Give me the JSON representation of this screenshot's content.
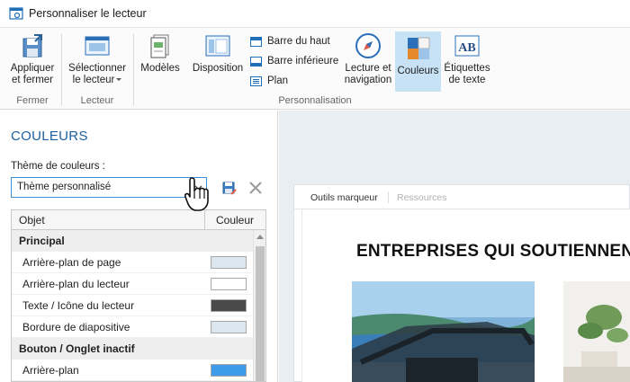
{
  "window": {
    "title": "Personnaliser le lecteur"
  },
  "ribbon": {
    "apply": {
      "line1": "Appliquer",
      "line2": "et fermer"
    },
    "select_player": {
      "line1": "Sélectionner",
      "line2": "le lecteur"
    },
    "templates": {
      "label": "Modèles"
    },
    "layout": {
      "label": "Disposition"
    },
    "top_bar": {
      "label": "Barre du haut"
    },
    "bottom_bar": {
      "label": "Barre inférieure"
    },
    "outline": {
      "label": "Plan"
    },
    "playback": {
      "line1": "Lecture et",
      "line2": "navigation"
    },
    "colors": {
      "label": "Couleurs"
    },
    "text_labels": {
      "line1": "Étiquettes",
      "line2": "de texte"
    },
    "groups": {
      "close": "Fermer",
      "player": "Lecteur",
      "customization": "Personnalisation"
    }
  },
  "panel": {
    "title": "COULEURS",
    "theme_label": "Thème de couleurs :",
    "theme_value": "Thème personnalisé",
    "table": {
      "col_object": "Objet",
      "col_color": "Couleur",
      "rows": [
        {
          "type": "section",
          "label": "Principal"
        },
        {
          "type": "item",
          "label": "Arrière-plan de page",
          "color": "#dce6ef"
        },
        {
          "type": "item",
          "label": "Arrière-plan du lecteur",
          "color": "#ffffff"
        },
        {
          "type": "item",
          "label": "Texte / Icône du lecteur",
          "color": "#4a4a4a"
        },
        {
          "type": "item",
          "label": "Bordure de diapositive",
          "color": "#dce6ef"
        },
        {
          "type": "section",
          "label": "Bouton / Onglet inactif"
        },
        {
          "type": "item",
          "label": "Arrière-plan",
          "color": "#3d9be9"
        }
      ]
    }
  },
  "preview": {
    "tab_active": "Outils marqueur",
    "tab_inactive": "Ressources",
    "slide_title": "ENTREPRISES QUI SOUTIENNENT"
  },
  "colors": {
    "accent": "#1e5fa0",
    "active_ribbon": "#c7e1f5",
    "preview_bg": "#e9eef3"
  }
}
